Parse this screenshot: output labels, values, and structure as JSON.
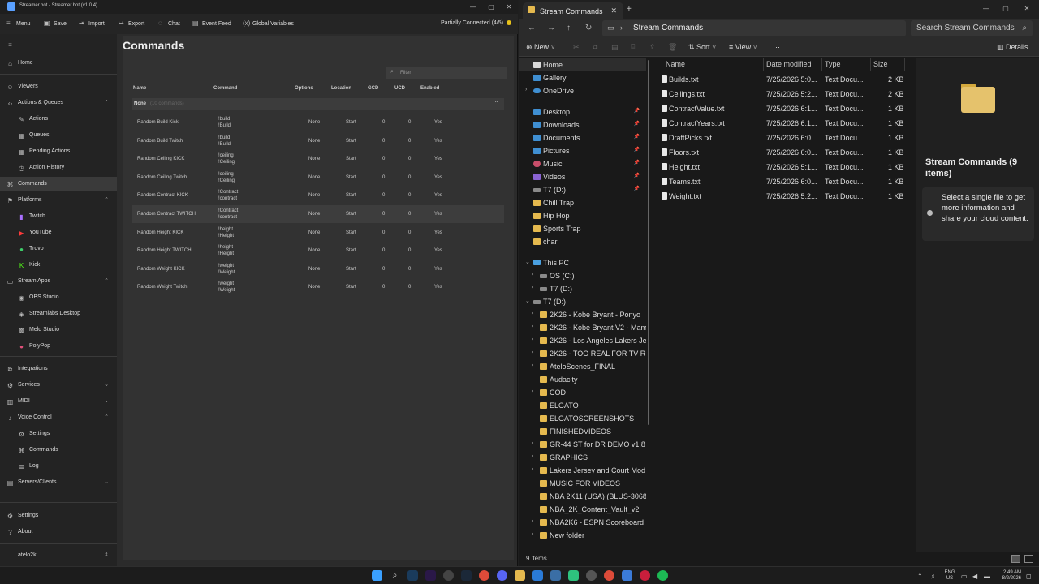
{
  "streamerbot": {
    "title": "Streamer.bot - Streamer.bot (v1.0.4)",
    "toolbar": {
      "menu": "Menu",
      "save": "Save",
      "import": "Import",
      "export": "Export",
      "chat": "Chat",
      "event_feed": "Event Feed",
      "global_variables": "Global Variables",
      "status": "Partially Connected (4/5)"
    },
    "sidebar": {
      "home": "Home",
      "viewers": "Viewers",
      "actions_queues": "Actions & Queues",
      "actions": "Actions",
      "queues": "Queues",
      "pending_actions": "Pending Actions",
      "action_history": "Action History",
      "commands": "Commands",
      "platforms": "Platforms",
      "twitch": "Twitch",
      "youtube": "YouTube",
      "trovo": "Trovo",
      "kick": "Kick",
      "stream_apps": "Stream Apps",
      "obs_studio": "OBS Studio",
      "streamlabs_desktop": "Streamlabs Desktop",
      "meld_studio": "Meld Studio",
      "polypop": "PolyPop",
      "integrations": "Integrations",
      "services": "Services",
      "midi": "MIDI",
      "voice_control": "Voice Control",
      "vc_settings": "Settings",
      "vc_commands": "Commands",
      "vc_log": "Log",
      "servers_clients": "Servers/Clients",
      "settings": "Settings",
      "about": "About",
      "profile": "atelo2k"
    },
    "main": {
      "heading": "Commands",
      "filter_placeholder": "Filter",
      "columns": {
        "name": "Name",
        "command": "Command",
        "options": "Options",
        "location": "Location",
        "gcd": "GCD",
        "ucd": "UCD",
        "enabled": "Enabled"
      },
      "group": {
        "label": "None",
        "count": "(10 commands)"
      },
      "rows": [
        {
          "name": "Random Build Kick",
          "cmd1": "!build",
          "cmd2": "!Build",
          "options": "None",
          "location": "Start",
          "gcd": "0",
          "ucd": "0",
          "enabled": "Yes"
        },
        {
          "name": "Random Build Twitch",
          "cmd1": "!build",
          "cmd2": "!Build",
          "options": "None",
          "location": "Start",
          "gcd": "0",
          "ucd": "0",
          "enabled": "Yes"
        },
        {
          "name": "Random Ceiling KICK",
          "cmd1": "!ceiling",
          "cmd2": "!Ceiling",
          "options": "None",
          "location": "Start",
          "gcd": "0",
          "ucd": "0",
          "enabled": "Yes"
        },
        {
          "name": "Random Ceiling Twitch",
          "cmd1": "!ceiling",
          "cmd2": "!Ceiling",
          "options": "None",
          "location": "Start",
          "gcd": "0",
          "ucd": "0",
          "enabled": "Yes"
        },
        {
          "name": "Random Contract KICK",
          "cmd1": "!Contract",
          "cmd2": "!contract",
          "options": "None",
          "location": "Start",
          "gcd": "0",
          "ucd": "0",
          "enabled": "Yes"
        },
        {
          "name": "Random Contract TWITCH",
          "cmd1": "!Contract",
          "cmd2": "!contract",
          "options": "None",
          "location": "Start",
          "gcd": "0",
          "ucd": "0",
          "enabled": "Yes"
        },
        {
          "name": "Random Height KICK",
          "cmd1": "!height",
          "cmd2": "!Height",
          "options": "None",
          "location": "Start",
          "gcd": "0",
          "ucd": "0",
          "enabled": "Yes"
        },
        {
          "name": "Random Height TWITCH",
          "cmd1": "!height",
          "cmd2": "!Height",
          "options": "None",
          "location": "Start",
          "gcd": "0",
          "ucd": "0",
          "enabled": "Yes"
        },
        {
          "name": "Random Weight KICK",
          "cmd1": "!weight",
          "cmd2": "!Weight",
          "options": "None",
          "location": "Start",
          "gcd": "0",
          "ucd": "0",
          "enabled": "Yes"
        },
        {
          "name": "Random Weight Twitch",
          "cmd1": "!weight",
          "cmd2": "!Weight",
          "options": "None",
          "location": "Start",
          "gcd": "0",
          "ucd": "0",
          "enabled": "Yes"
        }
      ]
    }
  },
  "explorer": {
    "tab_title": "Stream Commands",
    "path": "Stream Commands",
    "search_placeholder": "Search Stream Commands",
    "cmdbar": {
      "new": "New",
      "sort": "Sort",
      "view": "View",
      "more": "···",
      "details": "Details"
    },
    "nav": {
      "home": "Home",
      "gallery": "Gallery",
      "onedrive": "OneDrive",
      "quick": [
        "Desktop",
        "Downloads",
        "Documents",
        "Pictures",
        "Music",
        "Videos",
        "T7 (D:)",
        "Chill Trap",
        "Hip Hop",
        "Sports Trap",
        "char"
      ],
      "this_pc": "This PC",
      "os_c": "OS (C:)",
      "t7_d": "T7 (D:)",
      "t7_d_expanded": "T7 (D:)",
      "folders": [
        "2K26 - Kobe Bryant - Ponyo",
        "2K26 - Kobe Bryant V2 - Mamb",
        "2K26 - Los Angeles Lakers Jerse",
        "2K26 - TOO REAL FOR TV RESH",
        "AteloScenes_FINAL",
        "Audacity",
        "COD",
        "ELGATO",
        "ELGATOSCREENSHOTS",
        "FINISHEDVIDEOS",
        "GR-44 ST for DR DEMO v1.8 Co",
        "GRAPHICS",
        "Lakers Jersey and Court Mod M",
        "MUSIC FOR VIDEOS",
        "NBA 2K11 (USA) (BLUS-30689)",
        "NBA_2K_Content_Vault_v2",
        "NBA2K6 - ESPN Scoreboard by",
        "New folder"
      ]
    },
    "columns": {
      "name": "Name",
      "date": "Date modified",
      "type": "Type",
      "size": "Size"
    },
    "files": [
      {
        "name": "Builds.txt",
        "date": "7/25/2026 5:0...",
        "type": "Text Docu...",
        "size": "2 KB"
      },
      {
        "name": "Ceilings.txt",
        "date": "7/25/2026 5:2...",
        "type": "Text Docu...",
        "size": "2 KB"
      },
      {
        "name": "ContractValue.txt",
        "date": "7/25/2026 6:1...",
        "type": "Text Docu...",
        "size": "1 KB"
      },
      {
        "name": "ContractYears.txt",
        "date": "7/25/2026 6:1...",
        "type": "Text Docu...",
        "size": "1 KB"
      },
      {
        "name": "DraftPicks.txt",
        "date": "7/25/2026 6:0...",
        "type": "Text Docu...",
        "size": "1 KB"
      },
      {
        "name": "Floors.txt",
        "date": "7/25/2026 6:0...",
        "type": "Text Docu...",
        "size": "1 KB"
      },
      {
        "name": "Height.txt",
        "date": "7/25/2026 5:1...",
        "type": "Text Docu...",
        "size": "1 KB"
      },
      {
        "name": "Teams.txt",
        "date": "7/25/2026 6:0...",
        "type": "Text Docu...",
        "size": "1 KB"
      },
      {
        "name": "Weight.txt",
        "date": "7/25/2026 5:2...",
        "type": "Text Docu...",
        "size": "1 KB"
      }
    ],
    "details": {
      "title": "Stream Commands (9 items)",
      "info": "Select a single file to get more information and share your cloud content."
    },
    "status_count": "9 items"
  },
  "taskbar": {
    "lang1": "ENG",
    "lang2": "US",
    "time": "2:49 AM",
    "date": "8/2/2026"
  },
  "colors": {
    "accent": "#5aa0ff",
    "folder": "#e5b94e",
    "status_dot": "#e8c21a"
  }
}
